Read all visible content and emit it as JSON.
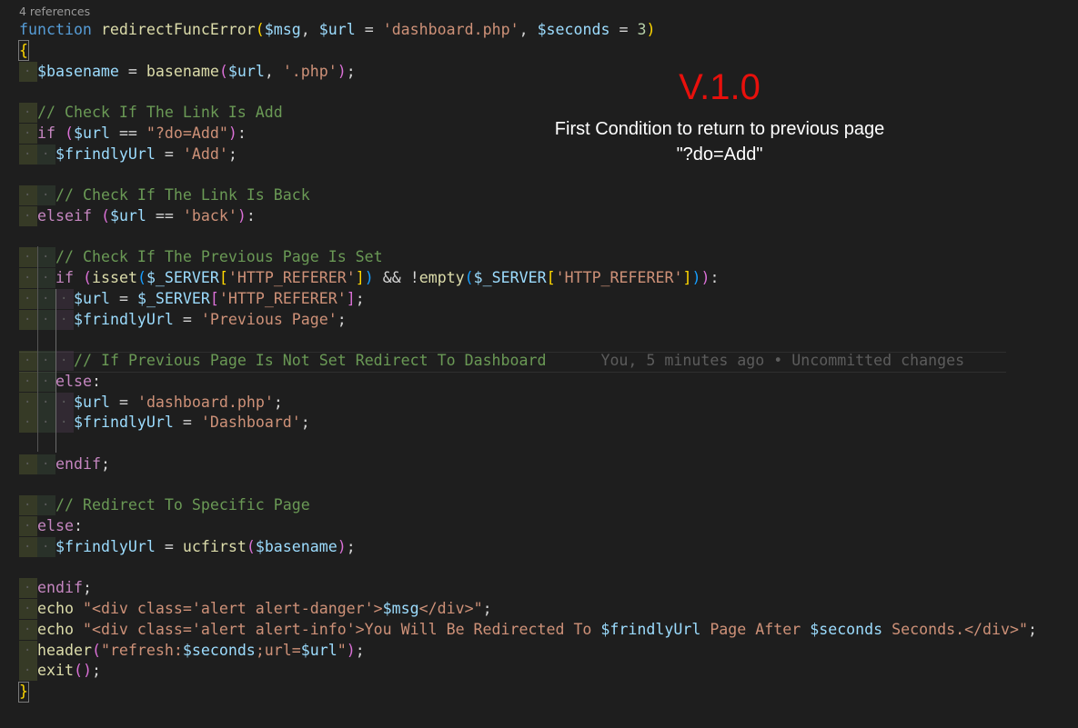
{
  "codelens": "4 references",
  "overlay": {
    "version": "V.1.0",
    "line1": "First Condition to return to previous page",
    "line2": "\"?do=Add\""
  },
  "blame": "You, 5 minutes ago • Uncommitted changes",
  "code": {
    "l1": {
      "kw": "function",
      "fn": "redirectFuncError",
      "p_open": "(",
      "v1": "$msg",
      "c1": ",",
      "v2": "$url",
      "eq1": " = ",
      "s1": "'dashboard.php'",
      "c2": ",",
      "v3": "$seconds",
      "eq2": " = ",
      "n1": "3",
      "p_close": ")"
    },
    "l2": {
      "brace": "{"
    },
    "l3": {
      "v1": "$basename",
      "eq": " = ",
      "fn": "basename",
      "p_open": "(",
      "v2": "$url",
      "c1": ",",
      "s1": "'.php'",
      "p_close": ")",
      "end": ";"
    },
    "l5": {
      "com": "// Check If The Link Is Add"
    },
    "l6": {
      "ctl": "if",
      "p_open": "(",
      "v1": "$url",
      "op": " == ",
      "s1": "\"?do=Add\"",
      "p_close": ")",
      "end": ":"
    },
    "l7": {
      "v1": "$frindlyUrl",
      "eq": " = ",
      "s1": "'Add'",
      "end": ";"
    },
    "l9": {
      "com": "// Check If The Link Is Back"
    },
    "l10": {
      "ctl": "elseif",
      "p_open": "(",
      "v1": "$url",
      "op": " == ",
      "s1": "'back'",
      "p_close": ")",
      "end": ":"
    },
    "l12": {
      "com": "// Check If The Previous Page Is Set"
    },
    "l13": {
      "ctl": "if",
      "p_open": "(",
      "fn1": "isset",
      "p2_open": "(",
      "v1": "$_SERVER",
      "b1_open": "[",
      "s1": "'HTTP_REFERER'",
      "b1_close": "]",
      "p2_close": ")",
      "and": " && ",
      "not": "!",
      "fn2": "empty",
      "p3_open": "(",
      "v2": "$_SERVER",
      "b2_open": "[",
      "s2": "'HTTP_REFERER'",
      "b2_close": "]",
      "p3_close": ")",
      "p_close": ")",
      "end": ":"
    },
    "l14": {
      "v1": "$url",
      "eq": " = ",
      "v2": "$_SERVER",
      "b_open": "[",
      "s1": "'HTTP_REFERER'",
      "b_close": "]",
      "end": ";"
    },
    "l15": {
      "v1": "$frindlyUrl",
      "eq": " = ",
      "s1": "'Previous Page'",
      "end": ";"
    },
    "l17": {
      "com": "// If Previous Page Is Not Set Redirect To Dashboard"
    },
    "l18": {
      "ctl": "else",
      "end": ":"
    },
    "l19": {
      "v1": "$url",
      "eq": " = ",
      "s1": "'dashboard.php'",
      "end": ";"
    },
    "l20": {
      "v1": "$frindlyUrl",
      "eq": " = ",
      "s1": "'Dashboard'",
      "end": ";"
    },
    "l22": {
      "ctl": "endif",
      "end": ";"
    },
    "l24": {
      "com": "// Redirect To Specific Page"
    },
    "l25": {
      "ctl": "else",
      "end": ":"
    },
    "l26": {
      "v1": "$frindlyUrl",
      "eq": " = ",
      "fn": "ucfirst",
      "p_open": "(",
      "v2": "$basename",
      "p_close": ")",
      "end": ";"
    },
    "l28": {
      "ctl": "endif",
      "end": ";"
    },
    "l29": {
      "fn": "echo",
      "s1": "\"<div class='alert alert-danger'>",
      "v1": "$msg",
      "s2": "</div>\"",
      "end": ";"
    },
    "l30": {
      "fn": "echo",
      "s1": "\"<div class='alert alert-info'>You Will Be Redirected To ",
      "v1": "$frindlyUrl",
      "s2": " Page After ",
      "v2": "$seconds",
      "s3": " Seconds.</div>\"",
      "end": ";"
    },
    "l31": {
      "fn": "header",
      "p_open": "(",
      "s1": "\"refresh:",
      "v1": "$seconds",
      "s2": ";url=",
      "v2": "$url",
      "s3": "\"",
      "p_close": ")",
      "end": ";"
    },
    "l32": {
      "fn": "exit",
      "p": "()",
      "end": ";"
    },
    "l33": {
      "brace": "}"
    }
  }
}
